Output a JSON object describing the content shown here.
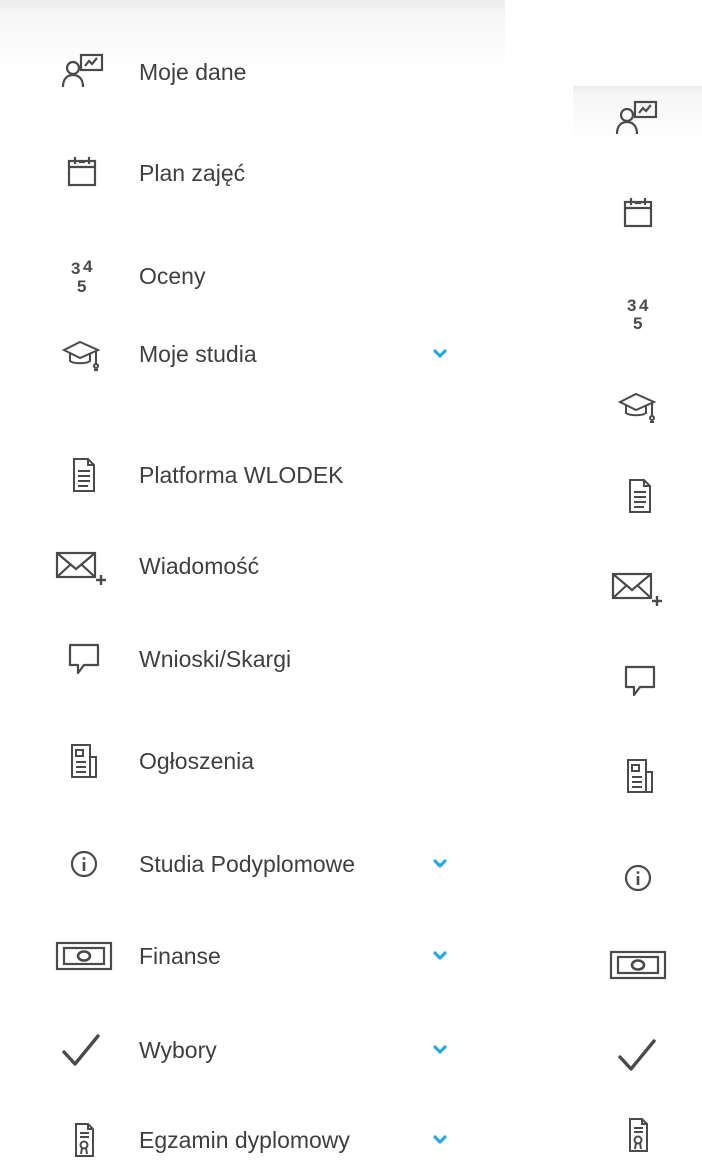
{
  "colors": {
    "text": "#3f3f3f",
    "icon": "#4a4a4a",
    "chevron": "#29a8e0"
  },
  "menu": {
    "items": [
      {
        "label": "Moje dane",
        "icon": "user-presentation-icon",
        "expandable": false
      },
      {
        "label": "Plan zajęć",
        "icon": "calendar-icon",
        "expandable": false
      },
      {
        "label": "Oceny",
        "icon": "grades-icon",
        "expandable": false
      },
      {
        "label": "Moje studia",
        "icon": "graduation-cap-icon",
        "expandable": true
      },
      {
        "label": "Platforma WLODEK",
        "icon": "document-icon",
        "expandable": false
      },
      {
        "label": "Wiadomość",
        "icon": "envelope-plus-icon",
        "expandable": false
      },
      {
        "label": "Wnioski/Skargi",
        "icon": "speech-bubble-icon",
        "expandable": false
      },
      {
        "label": "Ogłoszenia",
        "icon": "newspaper-icon",
        "expandable": false
      },
      {
        "label": "Studia Podyplomowe",
        "icon": "info-icon",
        "expandable": true
      },
      {
        "label": "Finanse",
        "icon": "banknote-icon",
        "expandable": true
      },
      {
        "label": "Wybory",
        "icon": "checkmark-icon",
        "expandable": true
      },
      {
        "label": "Egzamin dyplomowy",
        "icon": "certificate-document-icon",
        "expandable": true
      }
    ],
    "grades_icon_digits": [
      "3",
      "4",
      "5"
    ]
  }
}
